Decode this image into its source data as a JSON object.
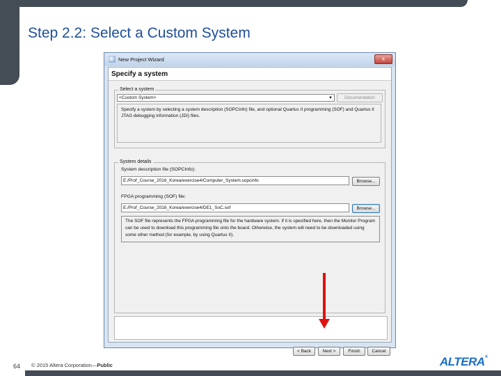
{
  "slide": {
    "title": "Step 2.2: Select a Custom System",
    "page_number": "64",
    "copyright_prefix": "© 2015 Altera Corporation—",
    "copyright_suffix": "Public",
    "logo": "ALTERA",
    "logo_reg": "®"
  },
  "window": {
    "title": "New Project Wizard",
    "close_glyph": "x"
  },
  "page": {
    "heading": "Specify a system"
  },
  "select_system": {
    "legend": "Select a system",
    "combo_value": "<Custom System>",
    "combo_arrow": "▼",
    "documentation_label": "Documentation",
    "description": "Specify a system by selecting a system description (SOPCInfo) file, and optional Quartus II programming (SOF) and Quartus II JTAG debugging information (JDI) files."
  },
  "system_details": {
    "legend": "System details",
    "sopc_label": "System description file (SOPCInfo):",
    "sopc_value": "E:/Prof_Course_2016_Korea/exercise4/Computer_System.sopcinfo",
    "browse1_label": "Browse...",
    "sof_label": "FPGA programming (SOF) file:",
    "sof_value": "E:/Prof_Course_2016_Korea/exercise4/DE1_SoC.sof",
    "browse2_label": "Browse...",
    "description": "The SOF file represents the FPGA programming file for the hardware system. If it is specified here, then the Monitor Program can be used to download this programming file onto the board. Otherwise, the system will need to be downloaded using some other method (for example, by using Quartus II)."
  },
  "footer": {
    "back_label": "< Back",
    "next_label": "Next >",
    "finish_label": "Finish",
    "cancel_label": "Cancel"
  },
  "colors": {
    "title_blue": "#1f4e9a",
    "slide_bar": "#444c55",
    "arrow_red": "#e01010",
    "logo_blue": "#1a6fc4"
  }
}
